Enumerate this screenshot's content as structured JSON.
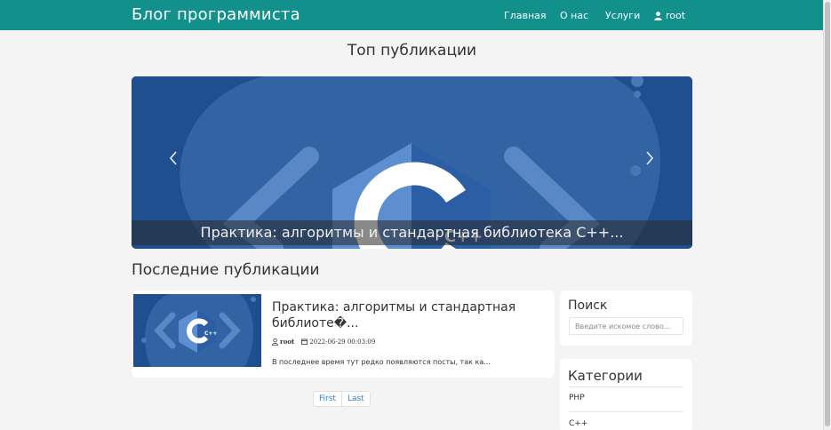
{
  "navbar": {
    "brand": "Блог программиста",
    "items": [
      {
        "label": "Главная"
      },
      {
        "label": "О нас"
      },
      {
        "label": "Услуги"
      },
      {
        "label": "root",
        "icon": "user-icon"
      }
    ],
    "color": "#12908c"
  },
  "top": {
    "title": "Топ публикации",
    "slide_caption": "Практика: алгоритмы и стандартная библиотека C++...",
    "slide_logo_text": "C++",
    "prev_icon": "chevron-left-icon",
    "next_icon": "chevron-right-icon"
  },
  "latest": {
    "title": "Последние публикации",
    "posts": [
      {
        "title": "Практика: алгоритмы и стандартная библиоте�...",
        "author": "root",
        "author_icon": "user-icon",
        "date": "2022-06-29 00:03:09",
        "date_icon": "calendar-icon",
        "excerpt": "В последнее время тут редко появляются посты, так ка..."
      }
    ]
  },
  "pagination": {
    "first": "First",
    "last": "Last"
  },
  "sidebar": {
    "search": {
      "title": "Поиск",
      "placeholder": "Введите искомое слово..."
    },
    "categories": {
      "title": "Категории",
      "items": [
        "PHP",
        "C++"
      ]
    }
  }
}
